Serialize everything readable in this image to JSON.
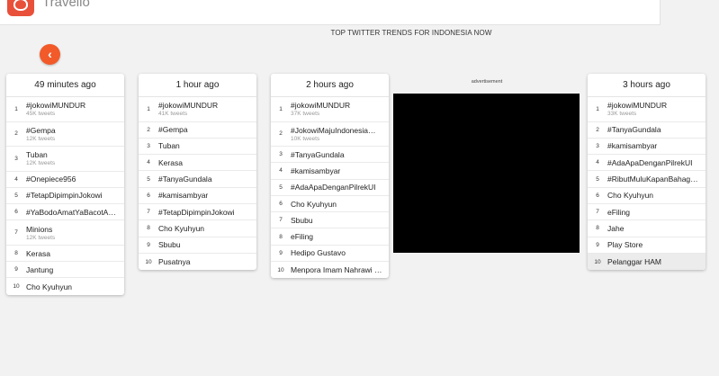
{
  "app": {
    "brand": "Travello"
  },
  "page": {
    "title": "TOP TWITTER TRENDS FOR INDONESIA NOW"
  },
  "ad": {
    "label": "advertisement"
  },
  "columns": [
    {
      "time": "49 minutes ago",
      "items": [
        {
          "rank": "1",
          "name": "#jokowiMUNDUR",
          "tweets": "45K tweets"
        },
        {
          "rank": "2",
          "name": "#Gempa",
          "tweets": "12K tweets"
        },
        {
          "rank": "3",
          "name": "Tuban",
          "tweets": "12K tweets"
        },
        {
          "rank": "4",
          "name": "#Onepiece956"
        },
        {
          "rank": "5",
          "name": "#TetapDipimpinJokowi"
        },
        {
          "rank": "6",
          "name": "#YaBodoAmatYaBacotA…"
        },
        {
          "rank": "7",
          "name": "Minions",
          "tweets": "12K tweets"
        },
        {
          "rank": "8",
          "name": "Kerasa"
        },
        {
          "rank": "9",
          "name": "Jantung"
        },
        {
          "rank": "10",
          "name": "Cho Kyuhyun"
        }
      ]
    },
    {
      "time": "1 hour ago",
      "items": [
        {
          "rank": "1",
          "name": "#jokowiMUNDUR",
          "tweets": "41K tweets"
        },
        {
          "rank": "2",
          "name": "#Gempa"
        },
        {
          "rank": "3",
          "name": "Tuban"
        },
        {
          "rank": "4",
          "name": "Kerasa"
        },
        {
          "rank": "5",
          "name": "#TanyaGundala"
        },
        {
          "rank": "6",
          "name": "#kamisambyar"
        },
        {
          "rank": "7",
          "name": "#TetapDipimpinJokowi"
        },
        {
          "rank": "8",
          "name": "Cho Kyuhyun"
        },
        {
          "rank": "9",
          "name": "Sbubu"
        },
        {
          "rank": "10",
          "name": "Pusatnya"
        }
      ]
    },
    {
      "time": "2 hours ago",
      "items": [
        {
          "rank": "1",
          "name": "#jokowiMUNDUR",
          "tweets": "37K tweets"
        },
        {
          "rank": "2",
          "name": "#JokowiMajuIndonesia…",
          "tweets": "10K tweets"
        },
        {
          "rank": "3",
          "name": "#TanyaGundala"
        },
        {
          "rank": "4",
          "name": "#kamisambyar"
        },
        {
          "rank": "5",
          "name": "#AdaApaDenganPilrekUI"
        },
        {
          "rank": "6",
          "name": "Cho Kyuhyun"
        },
        {
          "rank": "7",
          "name": "Sbubu"
        },
        {
          "rank": "8",
          "name": "eFiling"
        },
        {
          "rank": "9",
          "name": "Hedipo Gustavo"
        },
        {
          "rank": "10",
          "name": "Menpora Imam Nahrawi …"
        }
      ]
    },
    {
      "time": "3 hours ago",
      "items": [
        {
          "rank": "1",
          "name": "#jokowiMUNDUR",
          "tweets": "33K tweets"
        },
        {
          "rank": "2",
          "name": "#TanyaGundala"
        },
        {
          "rank": "3",
          "name": "#kamisambyar"
        },
        {
          "rank": "4",
          "name": "#AdaApaDenganPilrekUI"
        },
        {
          "rank": "5",
          "name": "#RibutMuluKapanBahag…"
        },
        {
          "rank": "6",
          "name": "Cho Kyuhyun"
        },
        {
          "rank": "7",
          "name": "eFiling"
        },
        {
          "rank": "8",
          "name": "Jahe"
        },
        {
          "rank": "9",
          "name": "Play Store"
        },
        {
          "rank": "10",
          "name": "Pelanggar HAM",
          "highlighted": true
        }
      ]
    }
  ]
}
